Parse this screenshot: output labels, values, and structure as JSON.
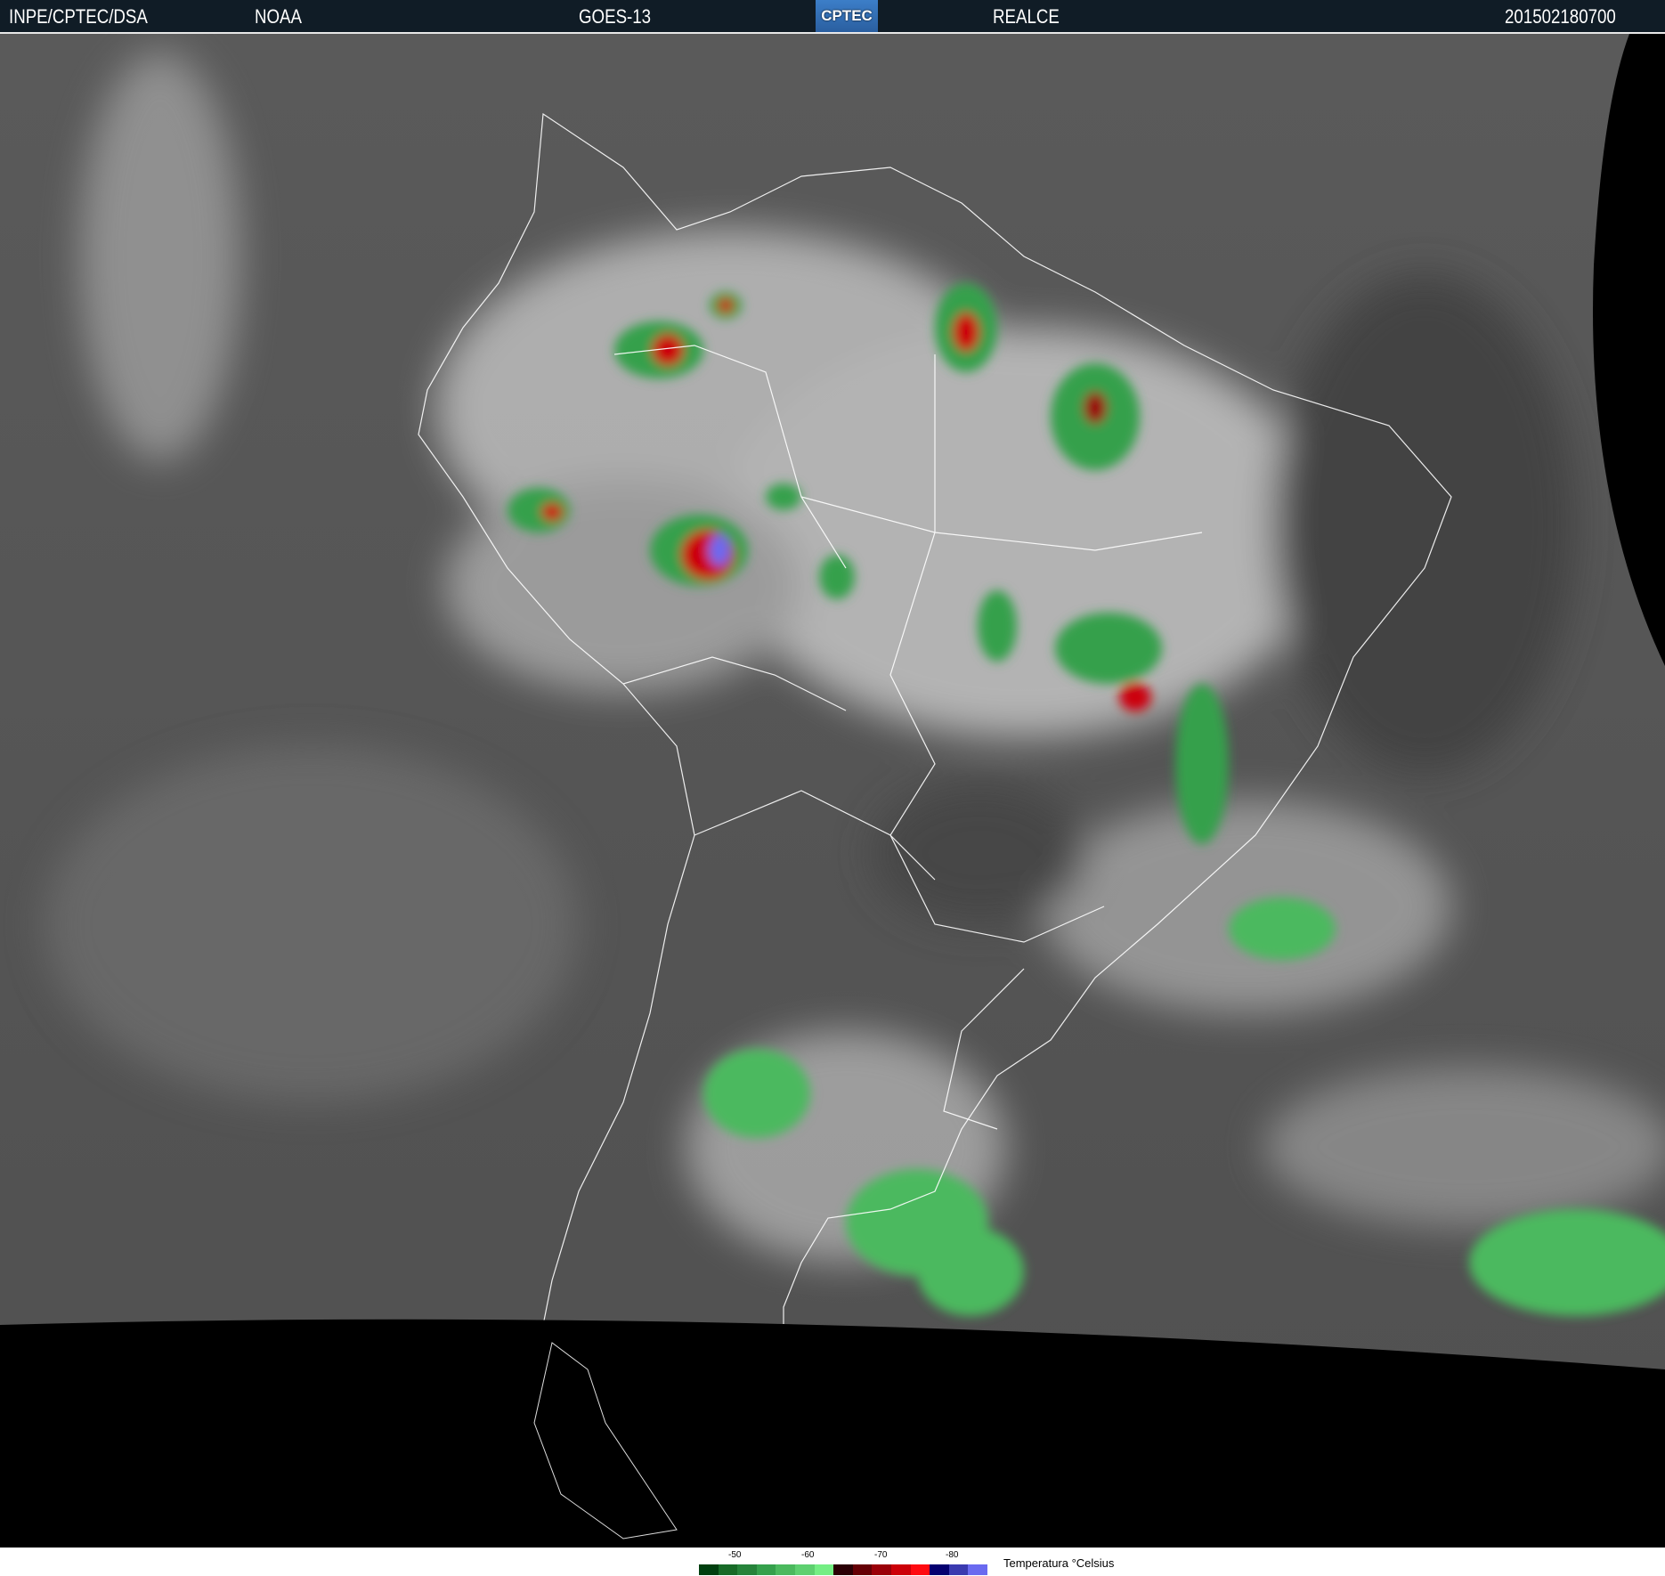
{
  "header": {
    "agency": "INPE/CPTEC/DSA",
    "source": "NOAA",
    "satellite": "GOES-13",
    "logo_text": "CPTEC",
    "product": "REALCE",
    "timestamp": "201502180700"
  },
  "legend": {
    "title": "Temperatura °Celsius",
    "ticks": [
      "-50",
      "-60",
      "-70",
      "-80"
    ],
    "colors": [
      "#003f0f",
      "#176a27",
      "#26833a",
      "#35a04c",
      "#4bb95e",
      "#5ed070",
      "#74ee84",
      "#2a0005",
      "#650005",
      "#9a0008",
      "#cc0008",
      "#ff0a10",
      "#050070",
      "#3a3ab0",
      "#6a6af0"
    ]
  }
}
